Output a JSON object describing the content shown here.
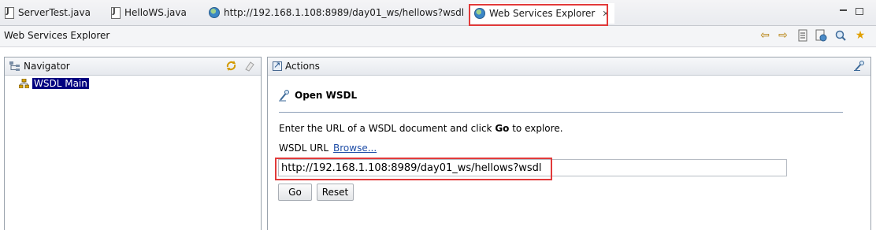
{
  "tabs": [
    {
      "label": "ServerTest.java",
      "icon": "java-file-icon"
    },
    {
      "label": "HelloWS.java",
      "icon": "java-file-icon"
    },
    {
      "label": "http://192.168.1.108:8989/day01_ws/hellows?wsdl",
      "icon": "globe-icon"
    },
    {
      "label": "Web Services Explorer",
      "icon": "globe-icon",
      "active": true,
      "close_glyph": "✕"
    }
  ],
  "view": {
    "title": "Web Services Explorer",
    "toolbar_icons": [
      "back-arrow-icon",
      "forward-arrow-icon",
      "history-icon",
      "wsdl-page-icon",
      "search-icon",
      "favorites-star-icon"
    ]
  },
  "navigator": {
    "title": "Navigator",
    "tree_item": "WSDL Main"
  },
  "actions": {
    "title": "Actions",
    "section_title": "Open WSDL",
    "instruction_pre": "Enter the URL of a WSDL document and click ",
    "instruction_bold": "Go",
    "instruction_post": " to explore.",
    "url_label": "WSDL URL",
    "browse_link": "Browse...",
    "url_value": "http://192.168.1.108:8989/day01_ws/hellows?wsdl",
    "go_label": "Go",
    "reset_label": "Reset"
  },
  "colors": {
    "highlight_red": "#e23a3a",
    "selection_bg": "#000080",
    "link_blue": "#1f4ea7"
  }
}
